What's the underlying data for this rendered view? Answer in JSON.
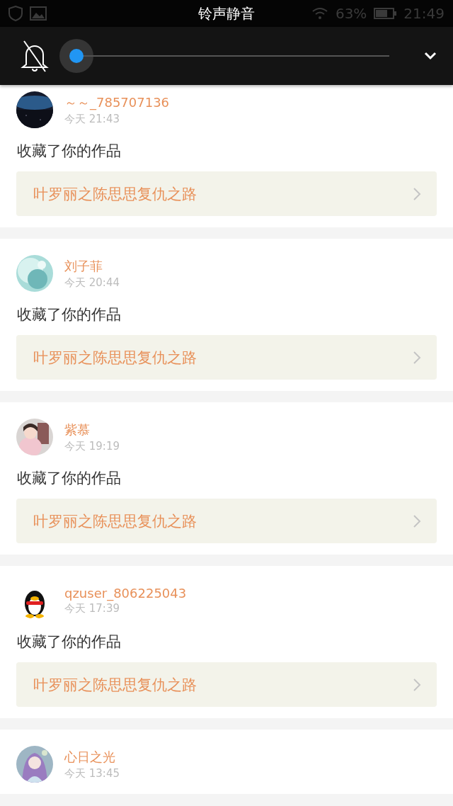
{
  "status_bar": {
    "battery": "63%",
    "time": "21:49"
  },
  "volume_panel": {
    "title": "铃声静音",
    "muted": true
  },
  "messages": [
    {
      "name": "～～_785707136",
      "time": "今天 21:43",
      "action": "收藏了你的作品",
      "work": "叶罗丽之陈思思复仇之路"
    },
    {
      "name": "刘子菲",
      "time": "今天 20:44",
      "action": "收藏了你的作品",
      "work": "叶罗丽之陈思思复仇之路"
    },
    {
      "name": "紫慕",
      "time": "今天 19:19",
      "action": "收藏了你的作品",
      "work": "叶罗丽之陈思思复仇之路"
    },
    {
      "name": "qzuser_806225043",
      "time": "今天 17:39",
      "action": "收藏了你的作品",
      "work": "叶罗丽之陈思思复仇之路"
    },
    {
      "name": "心日之光",
      "time": "今天 13:45"
    }
  ]
}
